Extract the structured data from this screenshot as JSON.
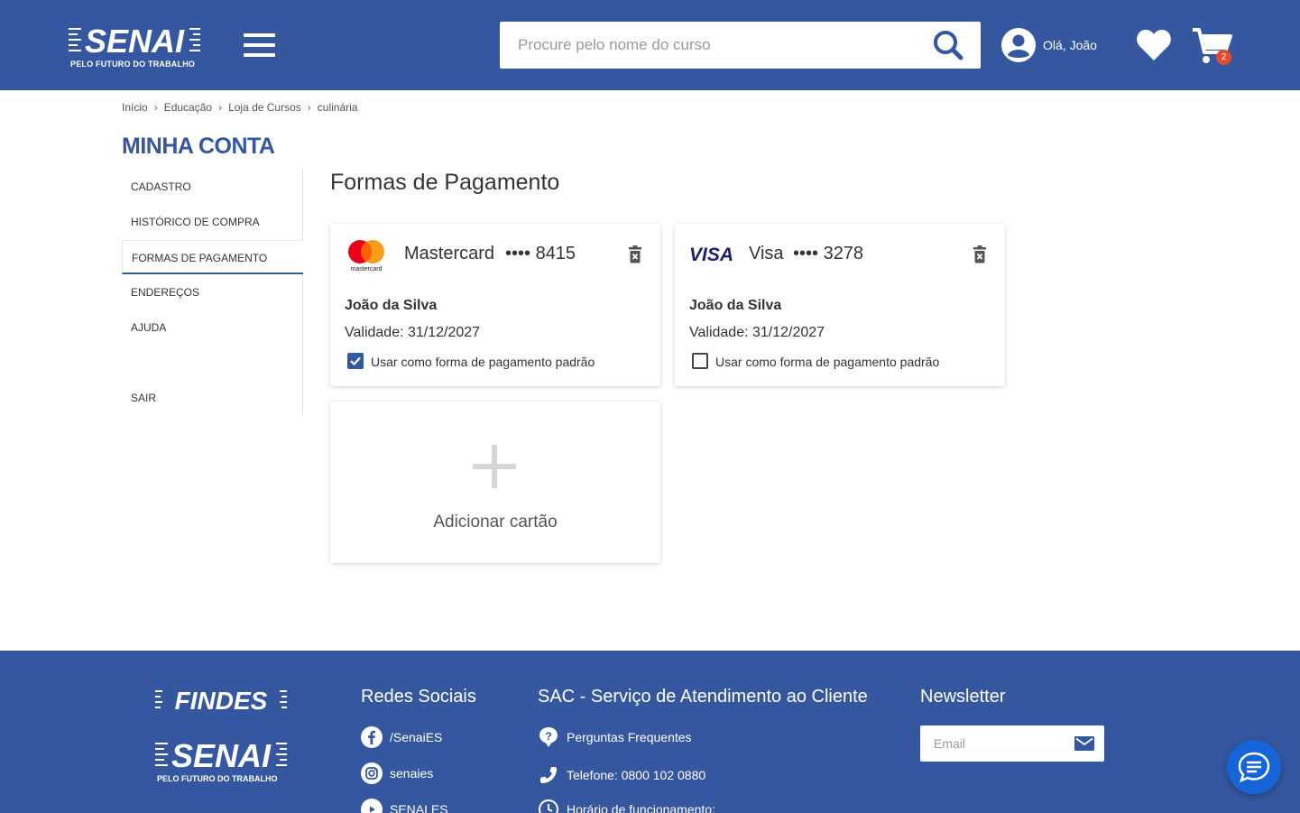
{
  "header": {
    "logo_text": "SENAI",
    "logo_tagline": "PELO FUTURO DO TRABALHO",
    "search_placeholder": "Procure pelo nome do curso",
    "user_greeting": "Olá, João",
    "cart_count": "2",
    "icons": [
      "menu-icon",
      "search-icon",
      "user-icon",
      "heart-icon",
      "cart-icon"
    ],
    "brand_color": "#3457a0",
    "badge_color": "#e04b2b"
  },
  "breadcrumb": [
    "Início",
    "Educação",
    "Loja de Cursos",
    "culinária"
  ],
  "sidebar": {
    "title": "MINHA CONTA",
    "items": [
      {
        "label": "CADASTRO",
        "active": false
      },
      {
        "label": "HISTÓRICO DE COMPRA",
        "active": false
      },
      {
        "label": "FORMAS DE PAGAMENTO",
        "active": true
      },
      {
        "label": "ENDEREÇOS",
        "active": false
      },
      {
        "label": "AJUDA",
        "active": false
      },
      {
        "label": "SAIR",
        "active": false
      }
    ]
  },
  "main": {
    "title": "Formas de Pagamento",
    "cards": [
      {
        "brand": "Mastercard",
        "brand_logo_text": "mastercard",
        "digits": "•••• 8415",
        "holder": "João da Silva",
        "validity": "Validade: 31/12/2027",
        "default_label": "Usar como forma de pagamento padrão",
        "is_default": true
      },
      {
        "brand": "Visa",
        "brand_logo_text": "VISA",
        "digits": "•••• 3278",
        "holder": "João da Silva",
        "validity": "Validade: 31/12/2027",
        "default_label": "Usar como forma de pagamento padrão",
        "is_default": false
      }
    ],
    "add_card_label": "Adicionar cartão"
  },
  "footer": {
    "logo_findes": "FINDES",
    "logo_senai": "SENAI",
    "logo_senai_tagline": "PELO FUTURO DO TRABALHO",
    "social": {
      "title": "Redes Sociais",
      "links": [
        {
          "icon": "facebook-icon",
          "label": "/SenaiES"
        },
        {
          "icon": "instagram-icon",
          "label": "senaies"
        },
        {
          "icon": "youtube-icon",
          "label": "SENAI ES"
        }
      ]
    },
    "sac": {
      "title": "SAC - Serviço de Atendimento ao Cliente",
      "links": [
        {
          "icon": "question-icon",
          "label": "Perguntas Frequentes"
        },
        {
          "icon": "phone-icon",
          "label": "Telefone: 0800 102 0880"
        },
        {
          "icon": "clock-icon",
          "label": "Horário de funcionamento:"
        }
      ]
    },
    "newsletter": {
      "title": "Newsletter",
      "placeholder": "Email"
    }
  }
}
